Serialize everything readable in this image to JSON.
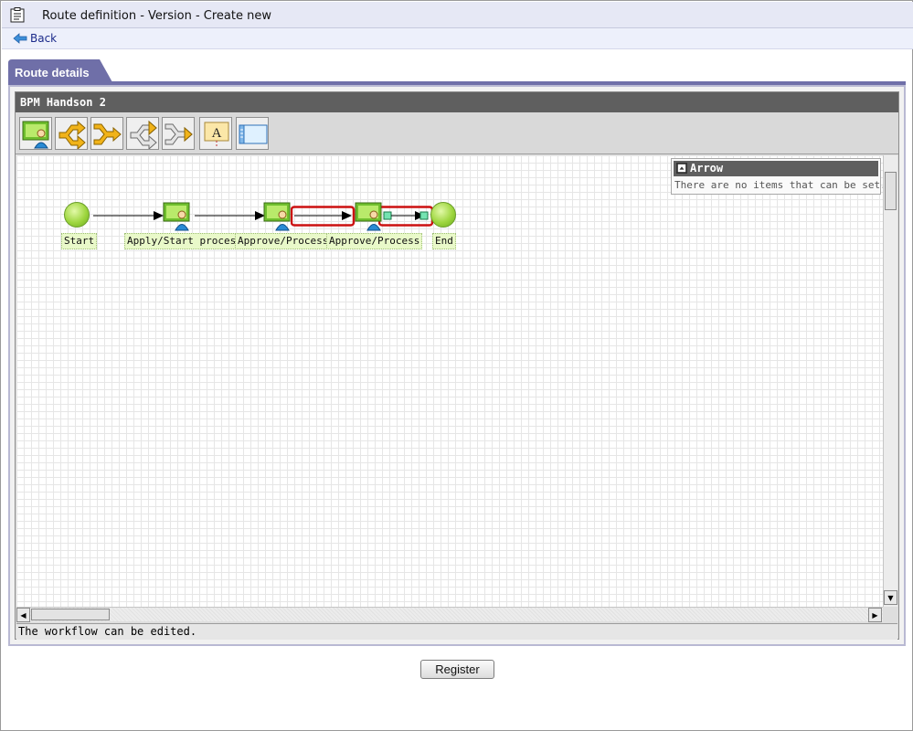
{
  "window": {
    "title": "Route definition - Version - Create new"
  },
  "nav": {
    "back_label": "Back"
  },
  "tabs": [
    {
      "label": "Route details"
    }
  ],
  "route": {
    "name": "BPM Handson 2"
  },
  "toolbar": {
    "tools": [
      {
        "icon": "task-node-icon"
      },
      {
        "icon": "branch-icon"
      },
      {
        "icon": "merge-icon"
      },
      {
        "icon": "branch-outline-icon"
      },
      {
        "icon": "merge-outline-icon"
      },
      {
        "icon": "text-label-icon",
        "glyph": "A"
      },
      {
        "icon": "panel-window-icon"
      }
    ]
  },
  "workflow": {
    "nodes": [
      {
        "type": "start",
        "label": "Start"
      },
      {
        "type": "task",
        "label": "Apply/Start process"
      },
      {
        "type": "task",
        "label": "Approve/Process"
      },
      {
        "type": "task",
        "label": "Approve/Process"
      },
      {
        "type": "end",
        "label": "End"
      }
    ]
  },
  "properties": {
    "title": "Arrow",
    "message": "There are no items that can be set."
  },
  "status": {
    "message": "The workflow can be edited."
  },
  "actions": {
    "register_label": "Register"
  },
  "colors": {
    "highlight": "#cc1111",
    "node_green": "#9ed63f",
    "tab": "#6f6fa8",
    "header": "#5f5f5f",
    "link": "#1b2a8a",
    "toolbar_arrow": "#f1b319"
  }
}
